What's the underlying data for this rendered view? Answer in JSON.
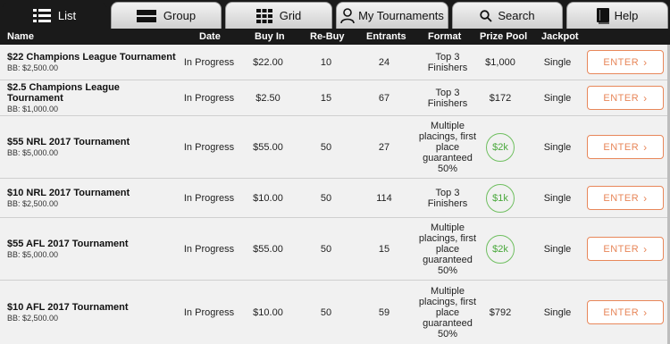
{
  "tabs": [
    {
      "label": "List",
      "icon": "list-icon",
      "active": true
    },
    {
      "label": "Group",
      "icon": "group-icon",
      "active": false
    },
    {
      "label": "Grid",
      "icon": "grid-icon",
      "active": false
    },
    {
      "label": "My Tournaments",
      "icon": "user-icon",
      "active": false
    },
    {
      "label": "Search",
      "icon": "search-icon",
      "active": false
    },
    {
      "label": "Help",
      "icon": "book-icon",
      "active": false
    }
  ],
  "columns": [
    "Name",
    "Date",
    "Buy In",
    "Re-Buy",
    "Entrants",
    "Format",
    "Prize Pool",
    "Jackpot"
  ],
  "enter_label": "ENTER",
  "colors": {
    "accent": "#e8875a",
    "badge": "#4aa83c",
    "header": "#1a1a1a"
  },
  "rows": [
    {
      "name": "$22 Champions League Tournament",
      "bb": "BB: $2,500.00",
      "date": "In Progress",
      "buyin": "$22.00",
      "rebuy": "10",
      "entrants": "24",
      "format": [
        "Top 3",
        "Finishers"
      ],
      "prize": "$1,000",
      "prize_badge": false,
      "jackpot": "Single"
    },
    {
      "name": "$2.5 Champions League Tournament",
      "bb": "BB: $1,000.00",
      "date": "In Progress",
      "buyin": "$2.50",
      "rebuy": "15",
      "entrants": "67",
      "format": [
        "Top 3",
        "Finishers"
      ],
      "prize": "$172",
      "prize_badge": false,
      "jackpot": "Single"
    },
    {
      "name": "$55 NRL 2017 Tournament",
      "bb": "BB: $5,000.00",
      "date": "In Progress",
      "buyin": "$55.00",
      "rebuy": "50",
      "entrants": "27",
      "format": [
        "Multiple",
        "placings, first",
        "place",
        "guaranteed",
        "50%"
      ],
      "prize": "$2k",
      "prize_badge": true,
      "jackpot": "Single"
    },
    {
      "name": "$10 NRL 2017 Tournament",
      "bb": "BB: $2,500.00",
      "date": "In Progress",
      "buyin": "$10.00",
      "rebuy": "50",
      "entrants": "114",
      "format": [
        "Top 3",
        "Finishers"
      ],
      "prize": "$1k",
      "prize_badge": true,
      "jackpot": "Single"
    },
    {
      "name": "$55 AFL 2017 Tournament",
      "bb": "BB: $5,000.00",
      "date": "In Progress",
      "buyin": "$55.00",
      "rebuy": "50",
      "entrants": "15",
      "format": [
        "Multiple",
        "placings, first",
        "place",
        "guaranteed",
        "50%"
      ],
      "prize": "$2k",
      "prize_badge": true,
      "jackpot": "Single"
    },
    {
      "name": "$10 AFL 2017 Tournament",
      "bb": "BB: $2,500.00",
      "date": "In Progress",
      "buyin": "$10.00",
      "rebuy": "50",
      "entrants": "59",
      "format": [
        "Multiple",
        "placings, first",
        "place",
        "guaranteed",
        "50%"
      ],
      "prize": "$792",
      "prize_badge": false,
      "jackpot": "Single"
    }
  ]
}
